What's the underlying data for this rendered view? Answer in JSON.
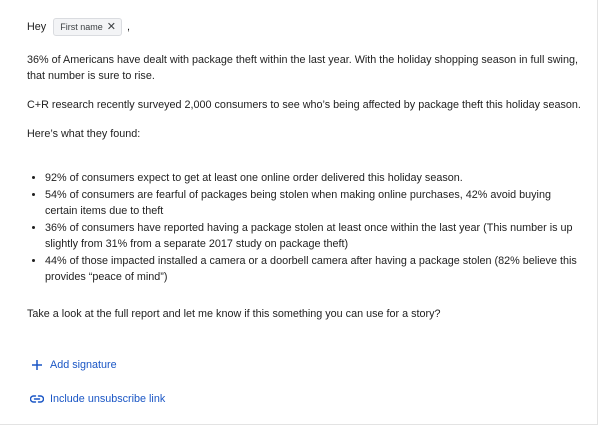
{
  "greeting": {
    "salutation": "Hey",
    "merge_field": "First name",
    "remove_glyph": "✕",
    "trailing": ","
  },
  "paragraphs": [
    "36% of Americans have dealt with package theft within the last year. With the holiday shopping season in full swing, that number is sure to rise.",
    "C+R research recently surveyed 2,000 consumers to see who’s being affected by package theft this holiday season.",
    "Here’s what they found:"
  ],
  "bullets": [
    "92% of consumers expect to get at least one online order delivered this holiday season.",
    "54% of consumers are fearful of packages being stolen when making online purchases, 42% avoid buying certain items due to theft",
    "36% of consumers have reported having a package stolen at least once within the last year (This number is up slightly from 31% from a separate 2017 study on package theft)",
    "44% of those impacted installed a camera or a doorbell camera after having a package stolen (82% believe this provides “peace of mind”)"
  ],
  "closing": "Take a look at the full report and let me know if this something you can use for a story?",
  "actions": {
    "add_signature": {
      "label": "Add signature",
      "icon": "plus-icon"
    },
    "unsubscribe": {
      "label": "Include unsubscribe link",
      "icon": "link-icon"
    }
  },
  "colors": {
    "link": "#1a56c5",
    "text": "#1f1f1f",
    "chip_bg": "#f3f4f6"
  }
}
